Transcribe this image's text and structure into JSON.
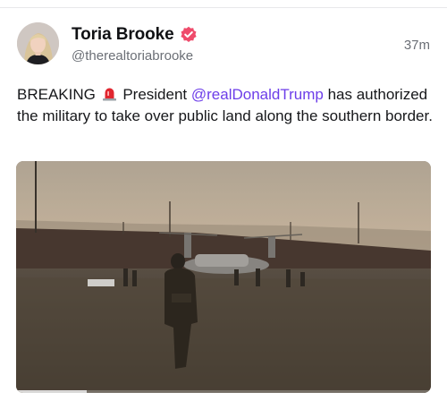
{
  "post": {
    "author": {
      "display_name": "Toria Brooke",
      "handle": "@therealtoriabrooke",
      "verified_icon": "verified-badge-icon"
    },
    "timestamp": "37m",
    "text": {
      "prefix": "BREAKING",
      "emoji": "rotating-light-icon",
      "middle": "President",
      "mention": "@realDonaldTrump",
      "suffix": "has authorized the military to take over public land along the southern border."
    },
    "media": {
      "type": "video",
      "progress": 0.17
    }
  },
  "colors": {
    "mention": "#6d3ee9",
    "verified_badge": "#ef4b6b",
    "secondary_text": "#6b6f76"
  }
}
